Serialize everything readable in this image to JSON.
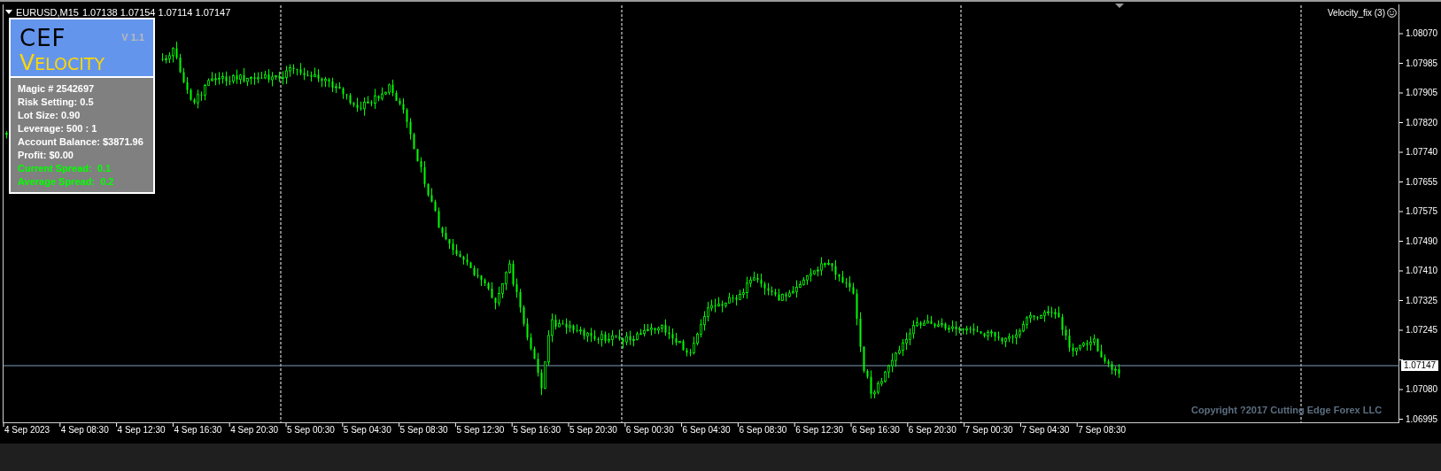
{
  "chart_header": {
    "symbol": "EURUSD,M15",
    "quote": "1.07138 1.07154 1.07114 1.07147"
  },
  "panel": {
    "logo_top": "CEF",
    "logo_bottom": "VELOCITY",
    "version": "V 1.1",
    "lines": [
      {
        "text": "Magic # 2542697",
        "kind": "info"
      },
      {
        "text": "Risk Setting: 0.5",
        "kind": "info"
      },
      {
        "text": "Lot Size: 0.90",
        "kind": "info"
      },
      {
        "text": "Leverage: 500 : 1",
        "kind": "info"
      },
      {
        "text": "Account Balance: $3871.96",
        "kind": "info"
      },
      {
        "text": "Profit: $0.00",
        "kind": "info"
      },
      {
        "text": "Current Spread:  0.1",
        "kind": "spread"
      },
      {
        "text": "Average Spread:  0.2",
        "kind": "spread"
      }
    ]
  },
  "indicator_label": "Velocity_fix (3)",
  "price_axis": {
    "ticks": [
      "1.08070",
      "1.07985",
      "1.07905",
      "1.07820",
      "1.07740",
      "1.07655",
      "1.07575",
      "1.07490",
      "1.07410",
      "1.07325",
      "1.07245"
    ],
    "ticks_below_price": [
      "1.07080",
      "1.06995"
    ],
    "current_price": "1.07147"
  },
  "time_axis": [
    "4 Sep 2023",
    "4 Sep 08:30",
    "4 Sep 12:30",
    "4 Sep 16:30",
    "4 Sep 20:30",
    "5 Sep 00:30",
    "5 Sep 04:30",
    "5 Sep 08:30",
    "5 Sep 12:30",
    "5 Sep 16:30",
    "5 Sep 20:30",
    "6 Sep 00:30",
    "6 Sep 04:30",
    "6 Sep 08:30",
    "6 Sep 12:30",
    "6 Sep 16:30",
    "6 Sep 20:30",
    "7 Sep 00:30",
    "7 Sep 04:30",
    "7 Sep 08:30"
  ],
  "copyright": "Copyright ?2017 Cutting Edge Forex LLC"
}
